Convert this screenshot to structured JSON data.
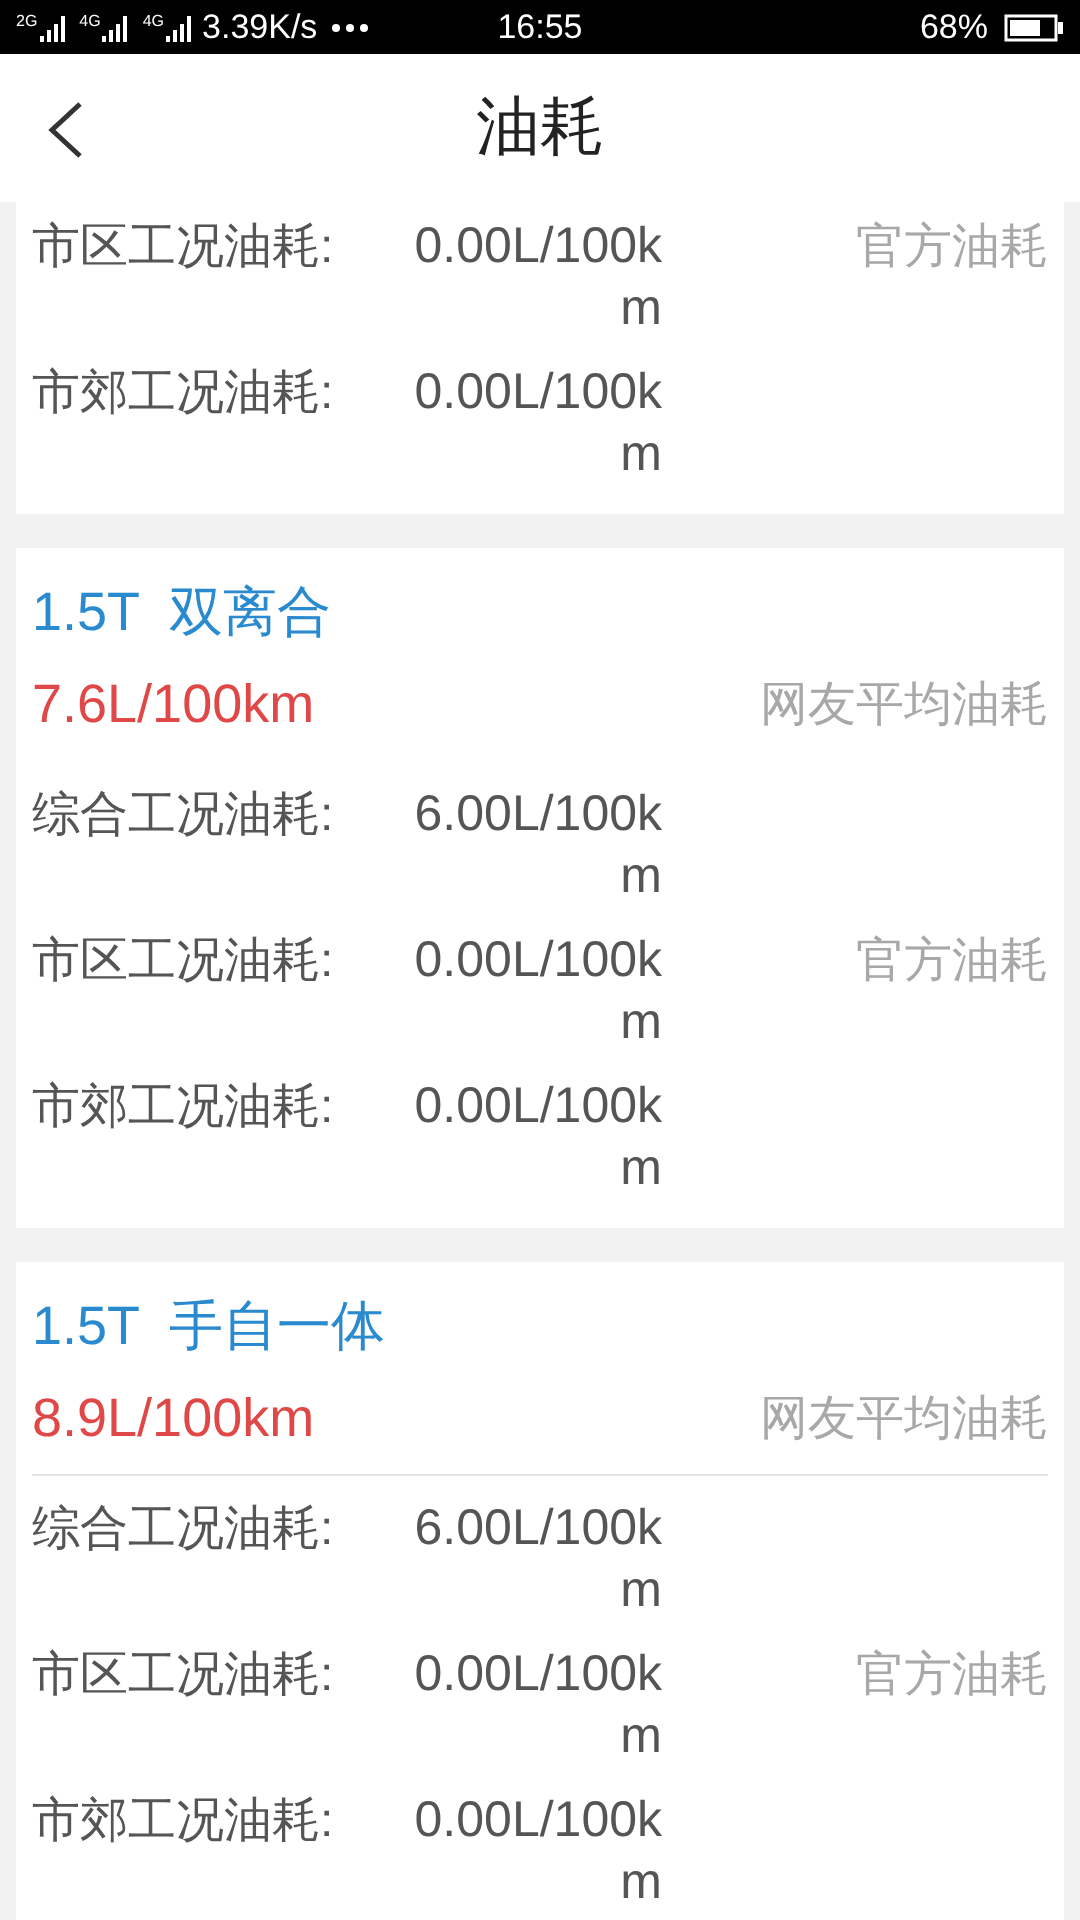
{
  "status_bar": {
    "networks": [
      "2G",
      "4G",
      "4G"
    ],
    "speed": "3.39K/s",
    "time": "16:55",
    "battery": "68%"
  },
  "header": {
    "title": "油耗"
  },
  "cards": [
    {
      "divider": false,
      "rows": [
        {
          "label": "市区工况油耗:",
          "value": "0.00L/100km",
          "tag": "官方油耗"
        },
        {
          "label": "市郊工况油耗:",
          "value": "0.00L/100km"
        }
      ]
    },
    {
      "title": "1.5T  双离合",
      "average": "7.6L/100km",
      "average_tag": "网友平均油耗",
      "divider": false,
      "rows": [
        {
          "label": "综合工况油耗:",
          "value": "6.00L/100km"
        },
        {
          "label": "市区工况油耗:",
          "value": "0.00L/100km",
          "tag": "官方油耗"
        },
        {
          "label": "市郊工况油耗:",
          "value": "0.00L/100km"
        }
      ]
    },
    {
      "title": "1.5T  手自一体",
      "average": "8.9L/100km",
      "average_tag": "网友平均油耗",
      "divider": true,
      "rows": [
        {
          "label": "综合工况油耗:",
          "value": "6.00L/100km"
        },
        {
          "label": "市区工况油耗:",
          "value": "0.00L/100km",
          "tag": "官方油耗"
        },
        {
          "label": "市郊工况油耗:",
          "value": "0.00L/100km"
        }
      ]
    }
  ]
}
